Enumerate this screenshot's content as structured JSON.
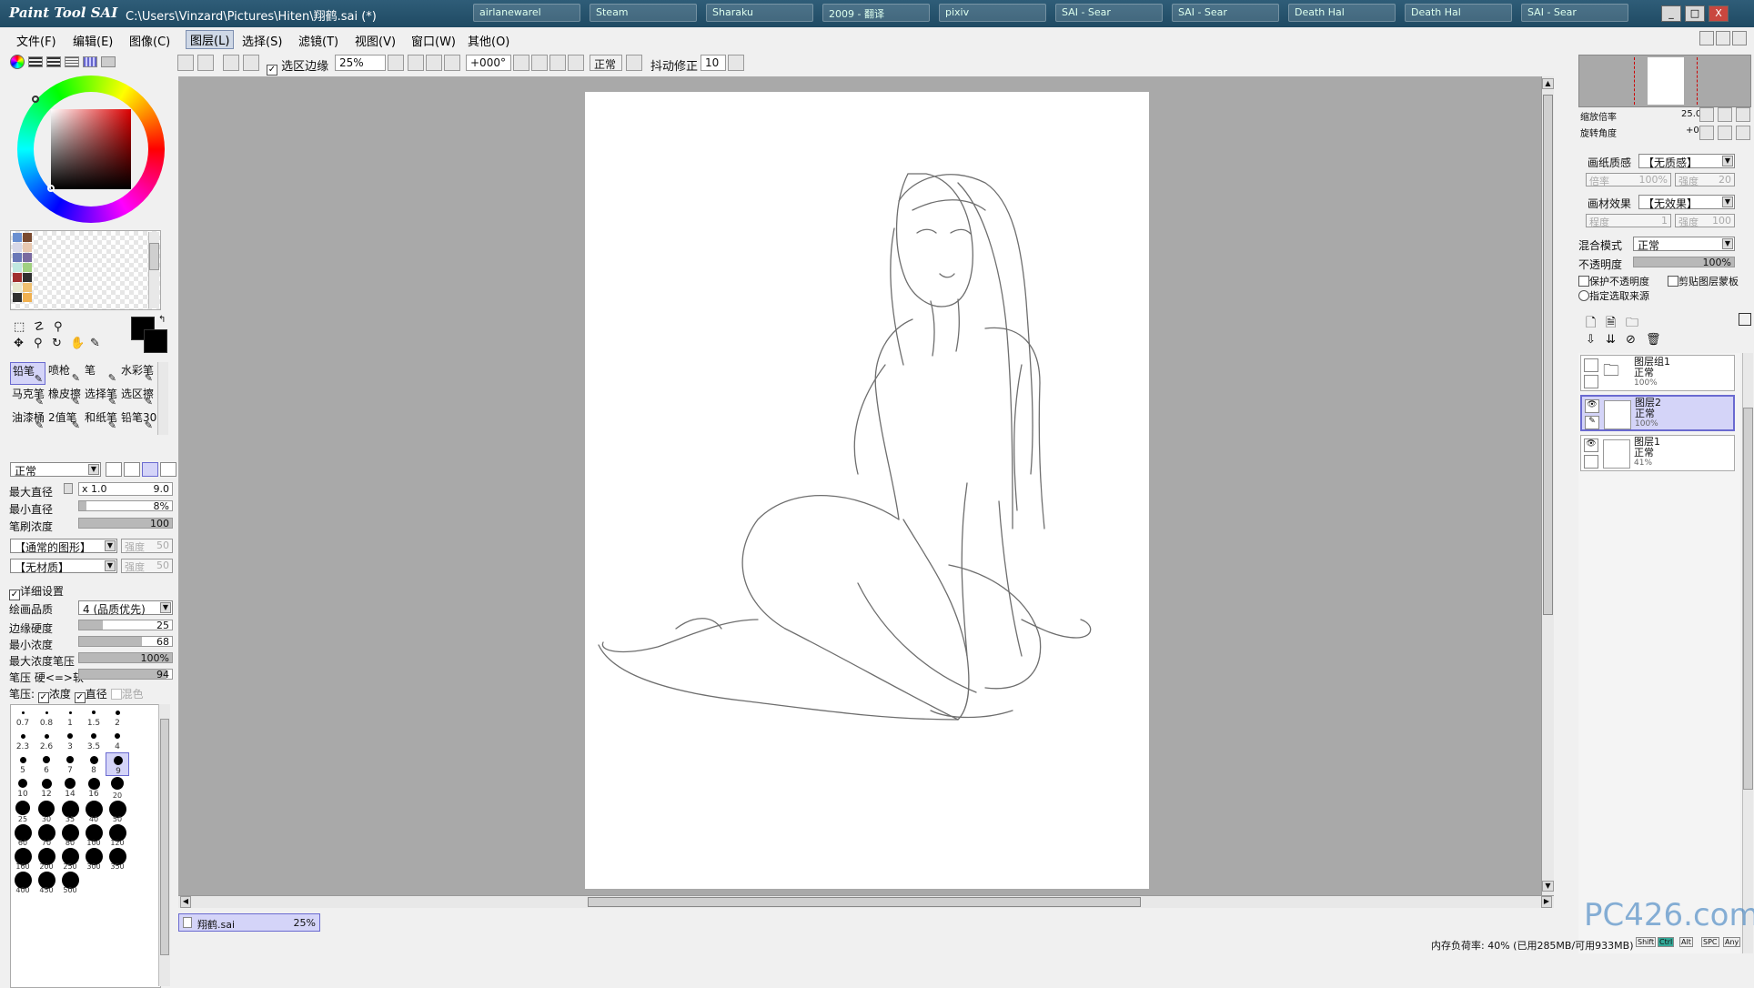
{
  "window": {
    "app_logo": "Paint Tool SAI",
    "title_path": "C:\\Users\\Vinzard\\Pictures\\Hiten\\翔鹤.sai (*)",
    "min_glyph": "_",
    "max_glyph": "□",
    "close_glyph": "X"
  },
  "taskbar": [
    "airlanewarel",
    "Steam",
    "Sharaku",
    "2009 - 翻译",
    "pixiv",
    "SAI - Sear",
    "SAI - Sear",
    "Death Hal",
    "Death Hal",
    "SAI - Sear"
  ],
  "menu": {
    "items": [
      "文件(F)",
      "编辑(E)",
      "图像(C)",
      "图层(L)",
      "选择(S)",
      "滤镜(T)",
      "视图(V)",
      "窗口(W)",
      "其他(O)"
    ],
    "active_index": 3
  },
  "toolbar": {
    "selection_edge_label": "选区边缘",
    "selection_edge_checked": "✓",
    "zoom_value": "25%",
    "rotation_value": "+000°",
    "blend_mode": "正常",
    "stabilizer_label": "抖动修正",
    "stabilizer_value": "10"
  },
  "palette": {
    "swatches": [
      "#6a8fd0",
      "#7a4a30",
      "#d8d8e8",
      "#e8c8b0",
      "#6a78b8",
      "#7a6aa0",
      "#c0e8e0",
      "#a0d080",
      "#a03030",
      "#303030",
      "#e8e8d0",
      "#f0c070",
      "#303030",
      "#f0b050"
    ],
    "primary_color": "#000000",
    "secondary_color": "#000000"
  },
  "tools": {
    "items": [
      "铅笔",
      "喷枪",
      "笔",
      "水彩笔",
      "马克笔",
      "橡皮擦",
      "选择笔",
      "选区擦",
      "油漆桶",
      "2值笔",
      "和纸笔",
      "铅笔30"
    ],
    "selected_index": 0
  },
  "brush": {
    "blend_mode": "正常",
    "max_diameter_label": "最大直径",
    "max_diameter_mult": "x 1.0",
    "max_diameter_value": "9.0",
    "min_diameter_label": "最小直径",
    "min_diameter_value": "8%",
    "min_diameter_pct": 8,
    "density_label": "笔刷浓度",
    "density_value": "100",
    "density_pct": 100,
    "shape_select": "【通常的图形】",
    "shape_strength_label": "强度",
    "shape_strength_value": "50",
    "texture_select": "【无材质】",
    "texture_strength_label": "强度",
    "texture_strength_value": "50",
    "details_label": "详细设置",
    "details_checked": "✓",
    "quality_label": "绘画品质",
    "quality_value": "4 (品质优先)",
    "edge_hardness_label": "边缘硬度",
    "edge_hardness_value": "25",
    "edge_hardness_pct": 25,
    "min_density_label": "最小浓度",
    "min_density_value": "68",
    "min_density_pct": 68,
    "max_density_pressure_label": "最大浓度笔压",
    "max_density_pressure_value": "100%",
    "max_density_pressure_pct": 100,
    "pressure_hardness_label": "笔压 硬<=>软",
    "pressure_hardness_value": "94",
    "pressure_hardness_pct": 94,
    "pressure_label": "笔压:",
    "pressure_density_label": "浓度",
    "pressure_diameter_label": "直径",
    "pressure_blend_label": "混色",
    "check_glyph": "✓"
  },
  "brush_sizes": {
    "sizes": [
      "0.7",
      "0.8",
      "1",
      "1.5",
      "2",
      "2.3",
      "2.6",
      "3",
      "3.5",
      "4",
      "5",
      "6",
      "7",
      "8",
      "9",
      "10",
      "12",
      "14",
      "16",
      "20",
      "25",
      "30",
      "35",
      "40",
      "50",
      "60",
      "70",
      "80",
      "100",
      "120",
      "160",
      "200",
      "250",
      "300",
      "350",
      "400",
      "450",
      "500"
    ],
    "selected": "9"
  },
  "document_tab": {
    "name": "翔鹤.sai",
    "zoom": "25%"
  },
  "navigator": {
    "zoom_label": "缩放倍率",
    "zoom_value": "25.0%",
    "rotate_label": "旋转角度",
    "rotate_value": "+000"
  },
  "paper": {
    "texture_label": "画纸质感",
    "texture_value": "【无质感】",
    "scale_label": "倍率",
    "scale_value": "100%",
    "strength_label": "强度",
    "strength_value": "20",
    "effect_label": "画材效果",
    "effect_value": "【无效果】",
    "degree_label": "程度",
    "degree_value": "1",
    "effect_strength_label": "强度",
    "effect_strength_value": "100"
  },
  "layer_props": {
    "blend_label": "混合模式",
    "blend_value": "正常",
    "opacity_label": "不透明度",
    "opacity_value": "100%",
    "protect_opacity_label": "保护不透明度",
    "clip_label": "剪贴图层蒙板",
    "source_label": "指定选取来源"
  },
  "layers": [
    {
      "name": "图层组1",
      "mode": "正常",
      "opacity": "100%"
    },
    {
      "name": "图层2",
      "mode": "正常",
      "opacity": "100%"
    },
    {
      "name": "图层1",
      "mode": "正常",
      "opacity": "41%"
    }
  ],
  "status": {
    "memory": "内存负荷率: 40% (已用285MB/可用933MB)",
    "keys": [
      "Shift",
      "Ctrl",
      "Alt",
      "SPC",
      "Any"
    ]
  },
  "watermark": "PC426.com"
}
